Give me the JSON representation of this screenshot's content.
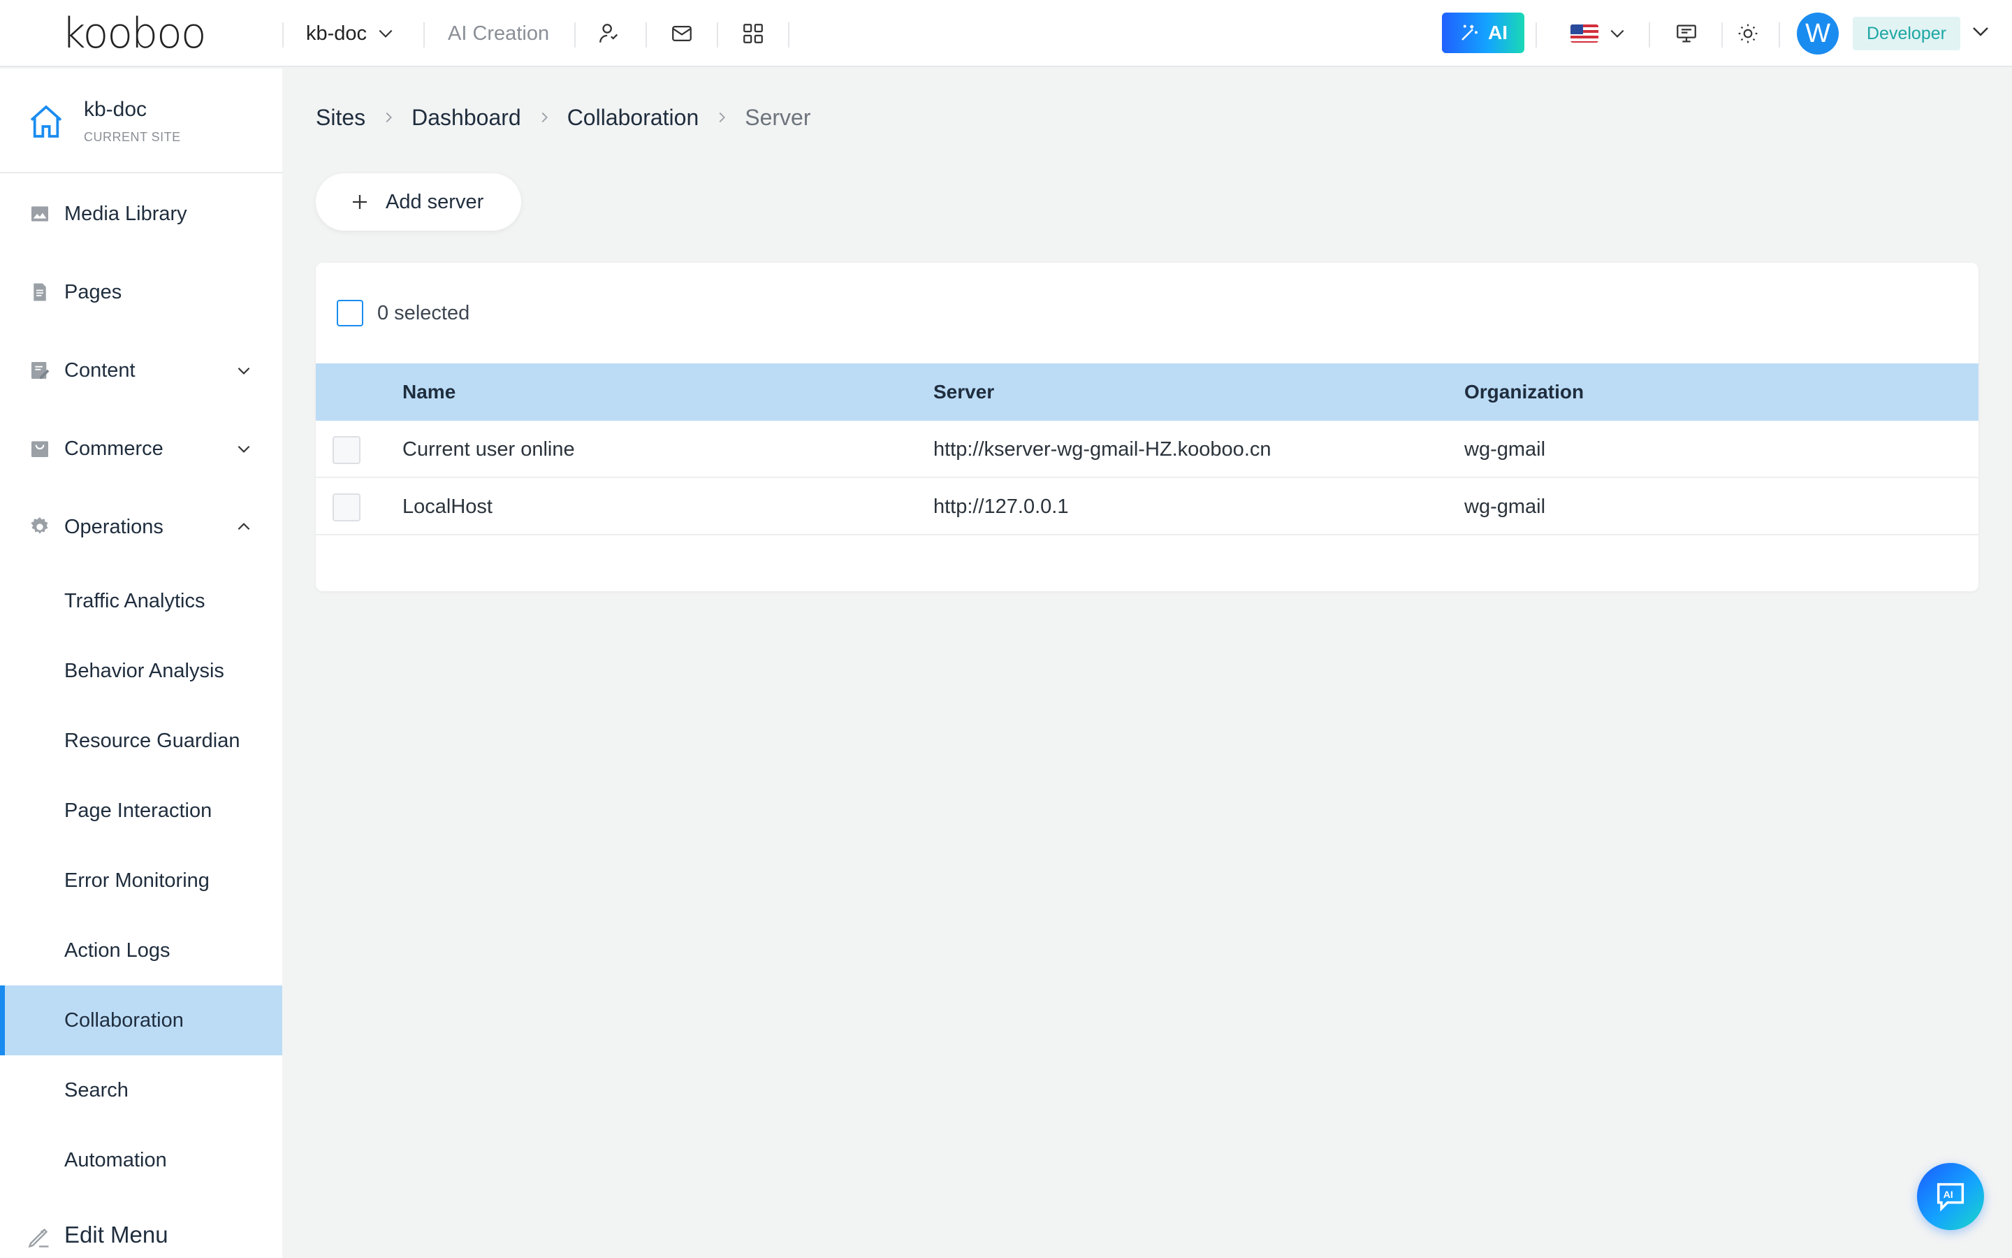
{
  "topbar": {
    "logo_text": "kooboo",
    "site_name": "kb-doc",
    "ai_creation": "AI Creation",
    "ai_button": "AI",
    "avatar_initial": "W",
    "role": "Developer",
    "icons": [
      "user-switch-icon",
      "mail-icon",
      "apps-grid-icon",
      "monitor-icon",
      "sun-icon"
    ]
  },
  "sidebar": {
    "current_site_name": "kb-doc",
    "current_site_caption": "CURRENT SITE",
    "items": [
      {
        "label": "Media Library",
        "icon": "image-icon"
      },
      {
        "label": "Pages",
        "icon": "page-icon"
      },
      {
        "label": "Content",
        "icon": "content-edit-icon",
        "expandable": true
      },
      {
        "label": "Commerce",
        "icon": "commerce-icon",
        "expandable": true
      },
      {
        "label": "Operations",
        "icon": "gear-icon",
        "expanded": true
      }
    ],
    "sub_items": [
      "Traffic Analytics",
      "Behavior Analysis",
      "Resource Guardian",
      "Page Interaction",
      "Error Monitoring",
      "Action Logs",
      "Collaboration",
      "Search",
      "Automation"
    ],
    "active_sub_item": "Collaboration",
    "edit_menu": "Edit Menu"
  },
  "breadcrumb": [
    "Sites",
    "Dashboard",
    "Collaboration",
    "Server"
  ],
  "actions": {
    "add_server": "Add server"
  },
  "table": {
    "selected_text": "0 selected",
    "columns": [
      "Name",
      "Server",
      "Organization"
    ],
    "rows": [
      {
        "name": "Current user online",
        "server": "http://kserver-wg-gmail-HZ.kooboo.cn",
        "organization": "wg-gmail"
      },
      {
        "name": "LocalHost",
        "server": "http://127.0.0.1",
        "organization": "wg-gmail"
      }
    ]
  },
  "chat_button": "AI",
  "colors": {
    "accent": "#1a8cf0",
    "active_bg": "#bcdcf6",
    "page_bg": "#f2f3f3",
    "role_text": "#1da7a3"
  }
}
